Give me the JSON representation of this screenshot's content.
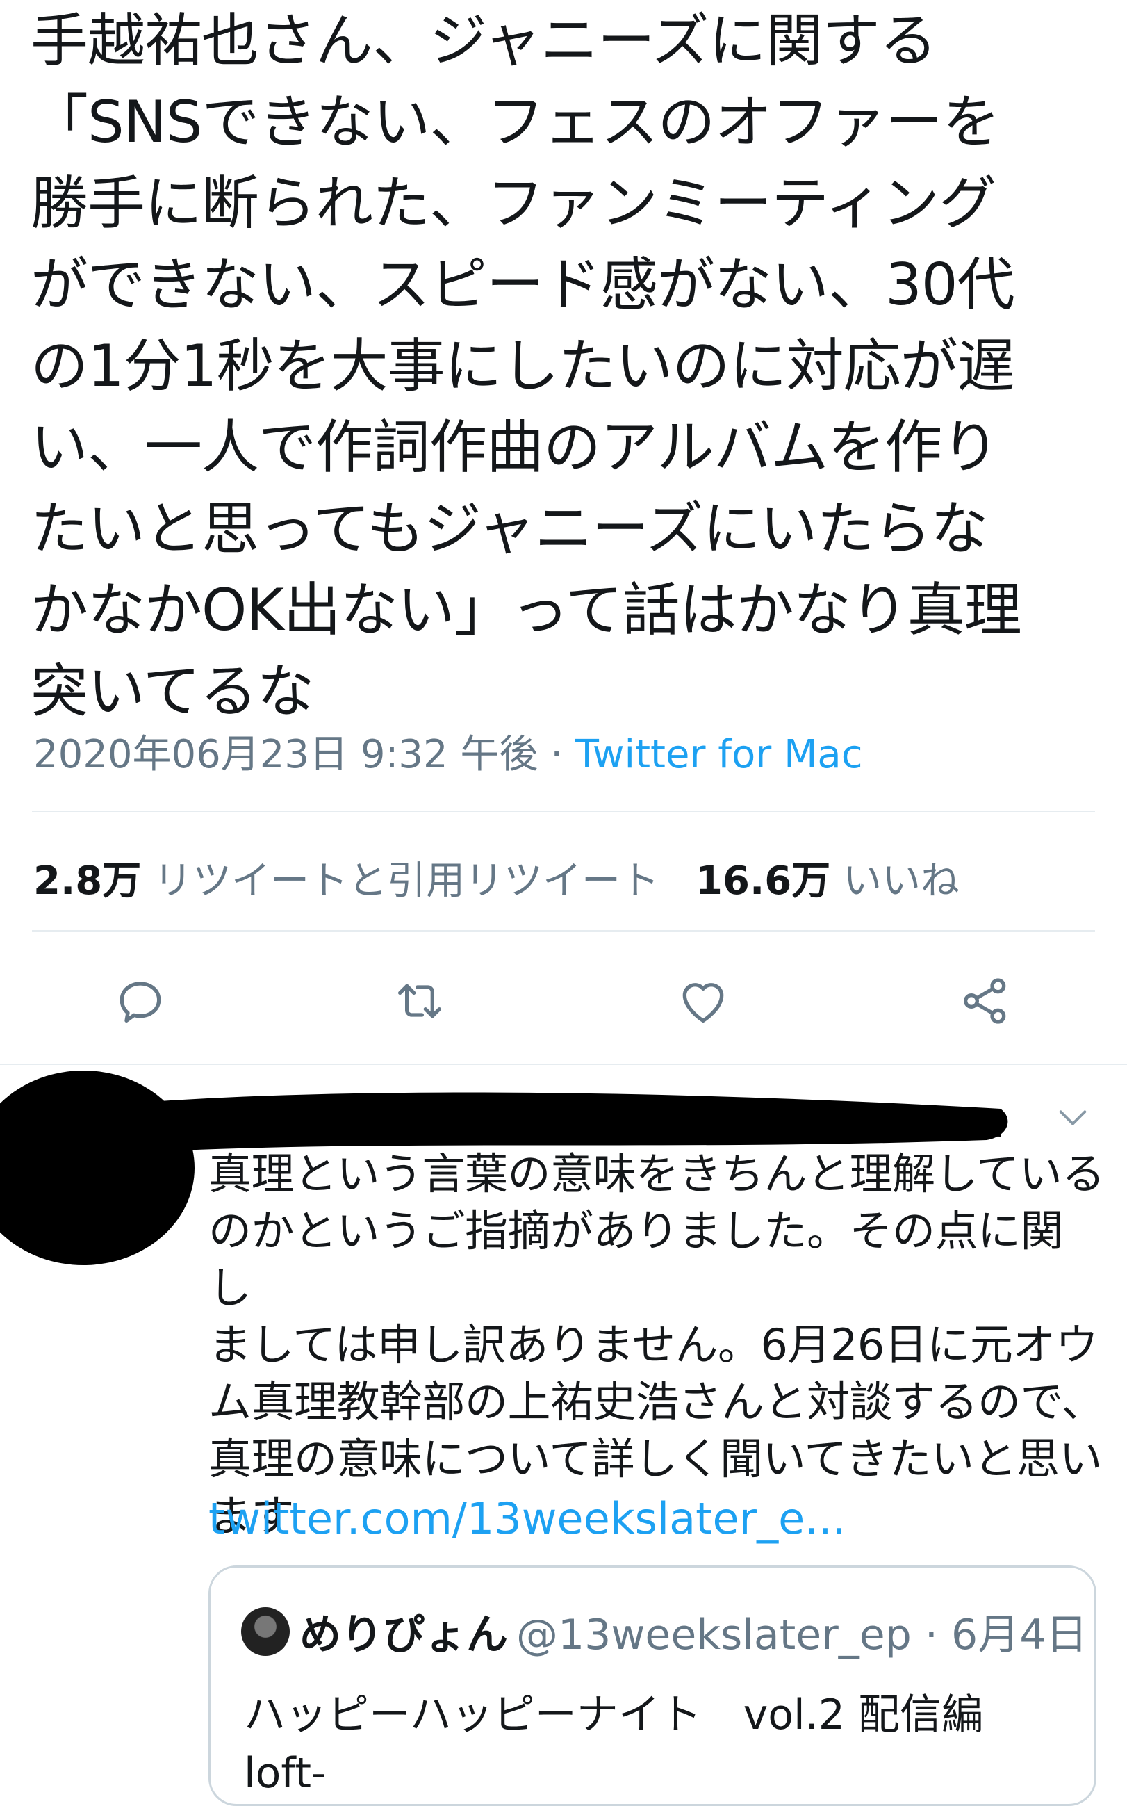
{
  "tweet": {
    "text": "手越祐也さん、ジャニーズに関する\n「SNSできない、フェスのオファーを\n勝手に断られた、ファンミーティング\nができない、スピード感がない、30代\nの1分1秒を大事にしたいのに対応が遅\nい、一人で作詞作曲のアルバムを作り\nたいと思ってもジャニーズにいたらな\nかなかOK出ない」って話はかなり真理\n突いてるな",
    "timestamp": "2020年06月23日 9:32 午後",
    "separator": " · ",
    "source": "Twitter for Mac",
    "retweet_count": "2.8万",
    "retweet_label": "リツイートと引用リツイート",
    "like_count": "16.6万",
    "like_label": "いいね"
  },
  "actions": [
    {
      "name": "reply",
      "icon": "reply-icon"
    },
    {
      "name": "retweet",
      "icon": "retweet-icon"
    },
    {
      "name": "like",
      "icon": "heart-icon"
    },
    {
      "name": "share",
      "icon": "share-icon"
    }
  ],
  "reply": {
    "text": "真理という言葉の意味をきちんと理解している\nのかというご指摘がありました。その点に関し\nましては申し訳ありません。6月26日に元オウ\nム真理教幹部の上祐史浩さんと対談するので、\n真理の意味について詳しく聞いてきたいと思い\nます",
    "link": "twitter.com/13weekslater_e...",
    "chevron_icon": "chevron-down-icon",
    "quoted": {
      "name": "めりぴょん",
      "handle": "@13weekslater_ep · 6月4日",
      "text": "ハッピーハッピーナイト　vol.2 配信編 loft-\nprj.co.jp/schedule/broad..."
    }
  },
  "colors": {
    "text": "#14171a",
    "secondary": "#657786",
    "accent": "#1da1f2",
    "divider": "#e6ecf0",
    "redaction": "#000000"
  }
}
